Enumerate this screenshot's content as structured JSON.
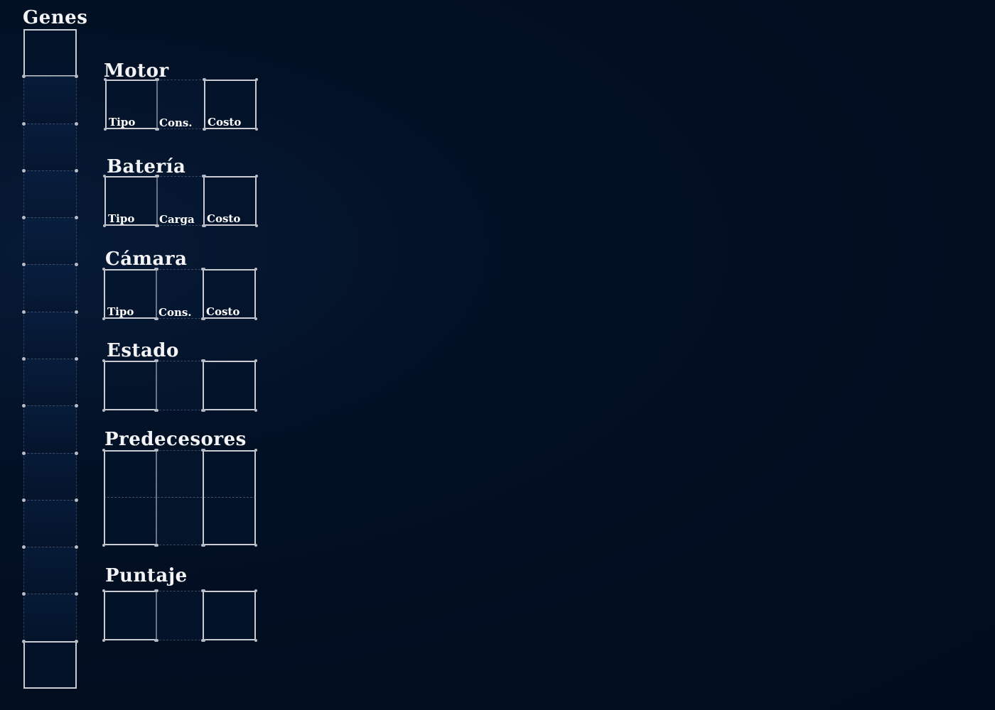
{
  "genes": {
    "title": "Genes",
    "slot_count": 14
  },
  "sections": [
    {
      "key": "motor",
      "title": "Motor",
      "labels": [
        "Tipo",
        "Cons.",
        "Costo"
      ],
      "rows": 1
    },
    {
      "key": "bateria",
      "title": "Batería",
      "labels": [
        "Tipo",
        "Carga",
        "Costo"
      ],
      "rows": 1
    },
    {
      "key": "camara",
      "title": "Cámara",
      "labels": [
        "Tipo",
        "Cons.",
        "Costo"
      ],
      "rows": 1
    },
    {
      "key": "estado",
      "title": "Estado",
      "labels": [],
      "rows": 1
    },
    {
      "key": "predecesores",
      "title": "Predecesores",
      "labels": [],
      "rows": 2
    },
    {
      "key": "puntaje",
      "title": "Puntaje",
      "labels": [],
      "rows": 1
    }
  ]
}
